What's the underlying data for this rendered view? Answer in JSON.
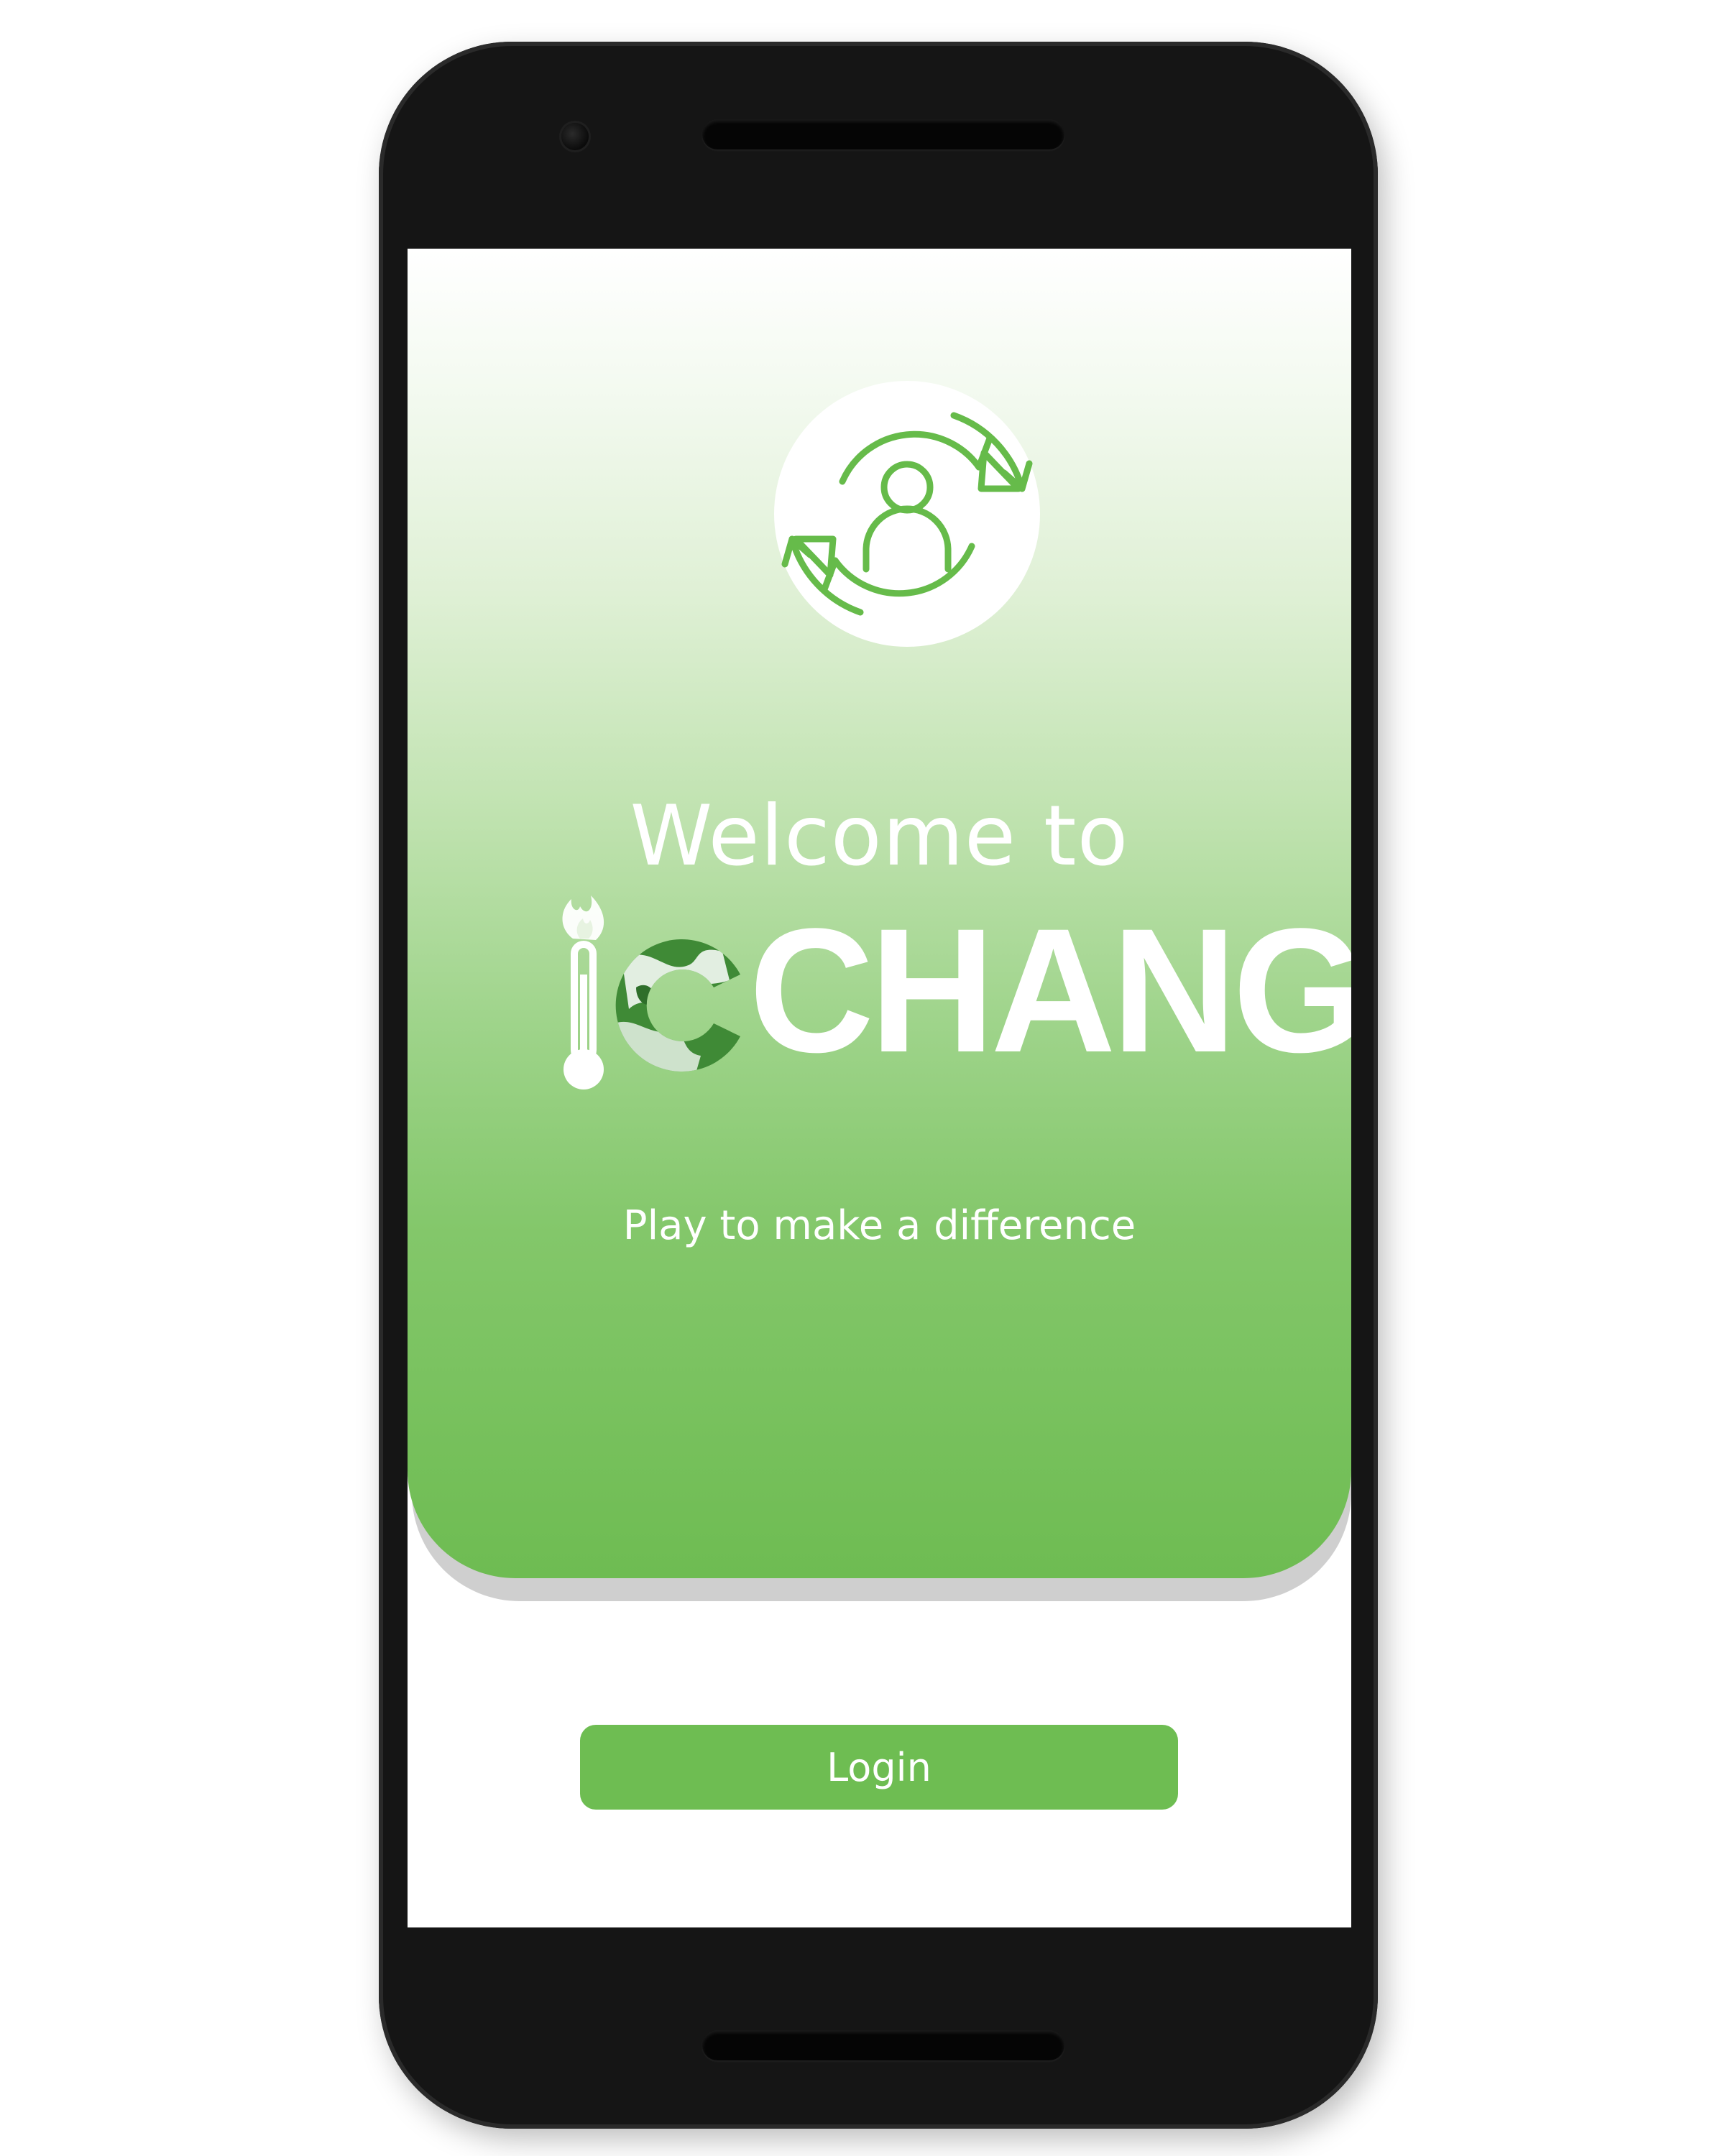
{
  "welcome": {
    "heading": "Welcome to",
    "brand_name": "CHANGE",
    "brand_full": "iCHANGE",
    "tagline": "Play to make a difference"
  },
  "actions": {
    "login_label": "Login"
  },
  "icons": {
    "logo": "person-recycle-icon",
    "thermometer": "thermometer-flame-icon",
    "globe": "globe-icon"
  },
  "colors": {
    "accent_green": "#6ebd52",
    "gradient_bottom": "#6ebc52",
    "phone_body": "#151515"
  }
}
